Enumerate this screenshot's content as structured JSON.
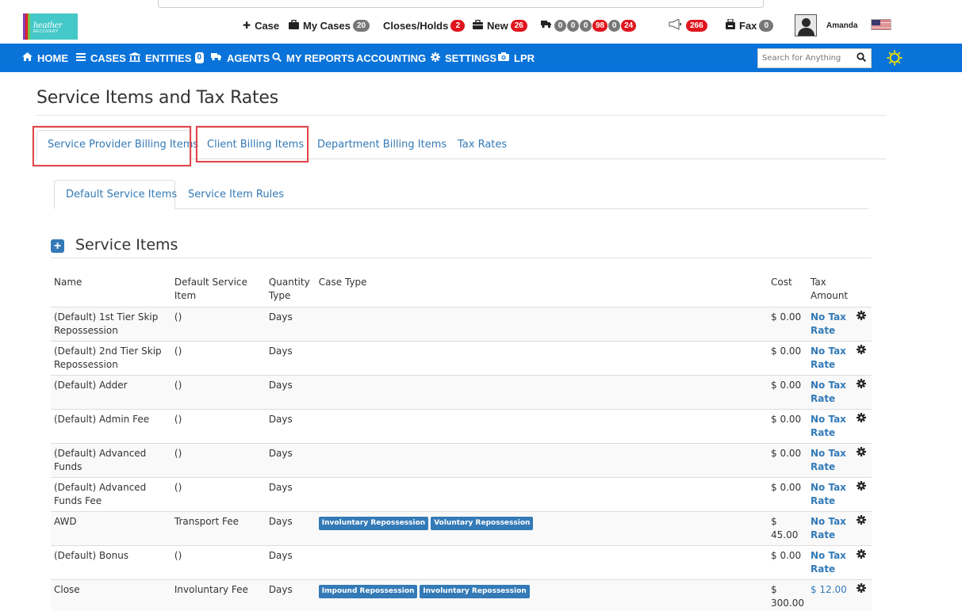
{
  "header": {
    "logo": {
      "line1": "heather",
      "line2": "RECOVERY"
    },
    "items": [
      {
        "icon": "plus-icon",
        "label": "Case"
      },
      {
        "icon": "briefcase-icon",
        "label": "My Cases",
        "badge": "20"
      },
      {
        "label": "Closes/Holds",
        "badge": "2"
      },
      {
        "icon": "toolbox-icon",
        "label": "New",
        "badge": "26"
      }
    ],
    "truck_badges": [
      "0",
      "0",
      "0",
      "98",
      "0",
      "24"
    ],
    "megaphone_badge": "266",
    "fax": {
      "label": "Fax",
      "badge": "0"
    },
    "user_name": "Amanda"
  },
  "nav": {
    "items": [
      "HOME",
      "CASES",
      "ENTITIES",
      "AGENTS",
      "MY REPORTS",
      "ACCOUNTING",
      "SETTINGS",
      "LPR"
    ],
    "entities_badge": "0",
    "search_placeholder": "Search for Anything"
  },
  "page": {
    "title": "Service Items and Tax Rates",
    "tabs": [
      "Service Provider Billing Items",
      "Client Billing Items",
      "Department Billing Items",
      "Tax Rates"
    ],
    "subtabs": [
      "Default Service Items",
      "Service Item Rules"
    ],
    "section_title": "Service Items"
  },
  "table": {
    "headers": {
      "name": "Name",
      "default_item": "Default Service Item",
      "qty_type": "Quantity Type",
      "case_type": "Case Type",
      "cost": "Cost",
      "tax": "Tax Amount"
    },
    "rows": [
      {
        "name": "(Default) 1st Tier Skip Repossession",
        "default_item": "()",
        "qty_type": "Days",
        "case_types": [],
        "cost": "$ 0.00",
        "tax": "No Tax Rate"
      },
      {
        "name": "(Default) 2nd Tier Skip Repossession",
        "default_item": "()",
        "qty_type": "Days",
        "case_types": [],
        "cost": "$ 0.00",
        "tax": "No Tax Rate"
      },
      {
        "name": "(Default) Adder",
        "default_item": "()",
        "qty_type": "Days",
        "case_types": [],
        "cost": "$ 0.00",
        "tax": "No Tax Rate"
      },
      {
        "name": "(Default) Admin Fee",
        "default_item": "()",
        "qty_type": "Days",
        "case_types": [],
        "cost": "$ 0.00",
        "tax": "No Tax Rate"
      },
      {
        "name": "(Default) Advanced Funds",
        "default_item": "()",
        "qty_type": "Days",
        "case_types": [],
        "cost": "$ 0.00",
        "tax": "No Tax Rate"
      },
      {
        "name": "(Default) Advanced Funds Fee",
        "default_item": "()",
        "qty_type": "Days",
        "case_types": [],
        "cost": "$ 0.00",
        "tax": "No Tax Rate"
      },
      {
        "name": "AWD",
        "default_item": "Transport Fee",
        "qty_type": "Days",
        "case_types": [
          "Involuntary Repossession",
          "Voluntary Repossession"
        ],
        "cost": "$ 45.00",
        "tax": "No Tax Rate"
      },
      {
        "name": "(Default) Bonus",
        "default_item": "()",
        "qty_type": "Days",
        "case_types": [],
        "cost": "$ 0.00",
        "tax": "No Tax Rate"
      },
      {
        "name": "Close",
        "default_item": "Involuntary Fee",
        "qty_type": "Days",
        "case_types": [
          "Impound Repossession",
          "Involuntary Repossession"
        ],
        "cost": "$ 300.00",
        "tax": "$ 12.00"
      }
    ]
  },
  "colors": {
    "nav_bg": "#0a73d9",
    "link": "#337ab7",
    "badge_red": "#e0151e",
    "badge_grey": "#777777",
    "highlight_box": "#e0474c",
    "sun": "#f0e000"
  }
}
